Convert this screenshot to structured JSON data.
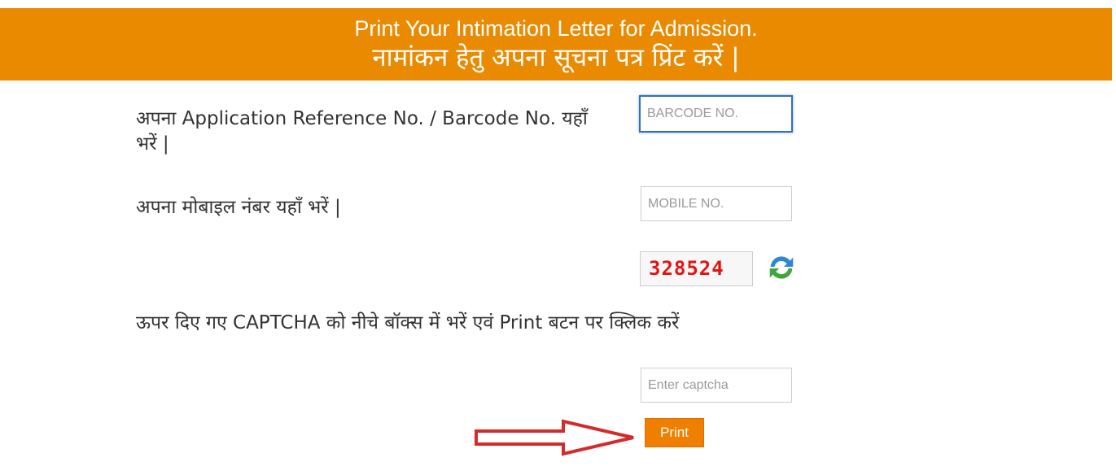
{
  "banner": {
    "title_en": "Print Your Intimation Letter for Admission.",
    "title_hi": "नामांकन हेतु अपना सूचना पत्र प्रिंट करें |"
  },
  "form": {
    "barcode_label": "अपना Application Reference No. / Barcode No. यहाँ भरें |",
    "barcode_placeholder": "BARCODE NO.",
    "mobile_label": "अपना मोबाइल नंबर यहाँ भरें |",
    "mobile_placeholder": "MOBILE NO.",
    "captcha_code": "328524",
    "captcha_instruction": "ऊपर दिए गए CAPTCHA को नीचे बॉक्स में भरें एवं Print बटन पर क्लिक करें",
    "captcha_placeholder": "Enter captcha",
    "print_label": "Print"
  },
  "icons": {
    "refresh": "refresh-icon",
    "arrow": "red-arrow-right"
  },
  "colors": {
    "banner": "#e98a00",
    "print_button": "#f07f00",
    "captcha_text": "#e01616",
    "arrow": "#d42a2a",
    "focus_border": "#2f6fc0"
  }
}
